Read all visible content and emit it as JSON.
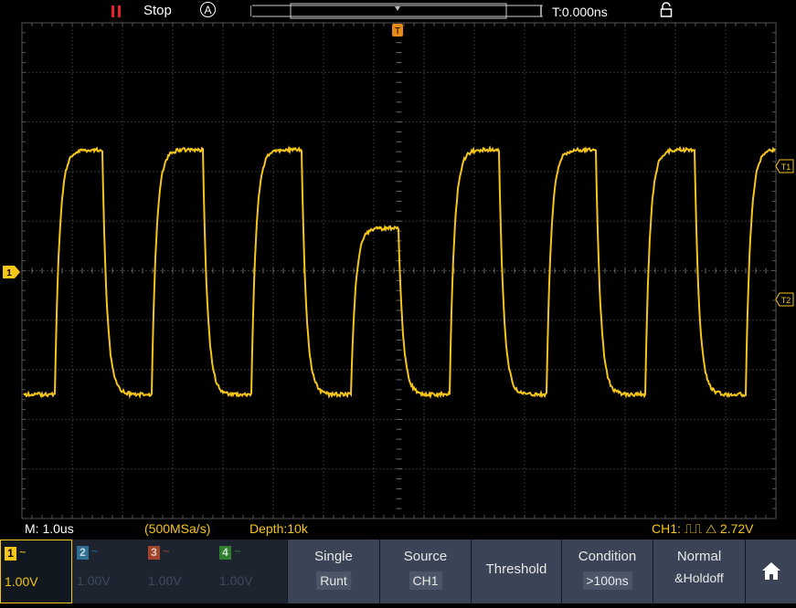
{
  "status": {
    "run_state": "Stop",
    "trigger_mode_icon": "auto-circle-A",
    "time_offset": "T:0.000ns"
  },
  "markers": {
    "trigger_top": "T",
    "ch1_marker": "1",
    "t1_label": "T1",
    "t2_label": "T2"
  },
  "infobar": {
    "timebase": "M: 1.0us",
    "sample_rate": "(500MSa/s)",
    "depth": "Depth:10k",
    "trigger_info": "CH1: ⎍⎍ △ 2.72V"
  },
  "channels": [
    {
      "num": "1",
      "coupling": "~",
      "volts": "1.00V",
      "color": "#f5c518",
      "active": true
    },
    {
      "num": "2",
      "coupling": "~",
      "volts": "1.00V",
      "color": "#2f8fc4",
      "active": false
    },
    {
      "num": "3",
      "coupling": "~",
      "volts": "1.00V",
      "color": "#c8552a",
      "active": false
    },
    {
      "num": "4",
      "coupling": "~",
      "volts": "1.00V",
      "color": "#3aa83a",
      "active": false
    }
  ],
  "menu": {
    "single": {
      "title": "Single",
      "value": "Runt"
    },
    "source": {
      "title": "Source",
      "value": "CH1"
    },
    "threshold": {
      "title": "Threshold"
    },
    "condition": {
      "title": "Condition",
      "value": ">100ns"
    },
    "mode": {
      "line1": "Normal",
      "line2": "&Holdoff"
    },
    "home_icon": "home-icon"
  },
  "colors": {
    "ch1": "#f5c518",
    "grid": "#5a5a5a",
    "trigger": "#e88a1a",
    "status_red": "#e8202a"
  }
}
